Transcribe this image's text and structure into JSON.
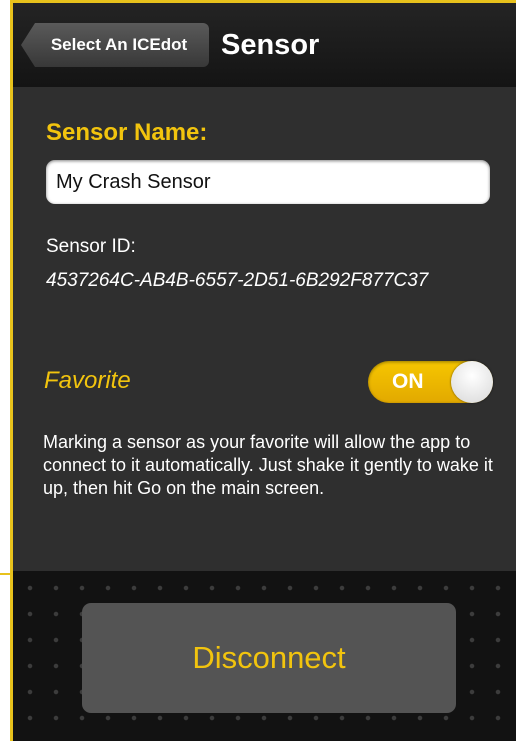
{
  "navbar": {
    "back_label": "Select An ICEdot",
    "title": "Sensor"
  },
  "sensor": {
    "name_label": "Sensor Name:",
    "name_value": "My Crash Sensor",
    "id_label": "Sensor ID:",
    "id_value": "4537264C-AB4B-6557-2D51-6B292F877C37"
  },
  "favorite": {
    "label": "Favorite",
    "toggle_text": "ON",
    "toggle_state": true,
    "description": "Marking a sensor as your favorite will allow the app to connect to it automatically. Just shake it gently to wake it up, then hit Go on the main screen."
  },
  "actions": {
    "disconnect_label": "Disconnect"
  },
  "colors": {
    "accent": "#f2c40e",
    "background": "#2f2f2f",
    "frame": "#e8c21c"
  }
}
